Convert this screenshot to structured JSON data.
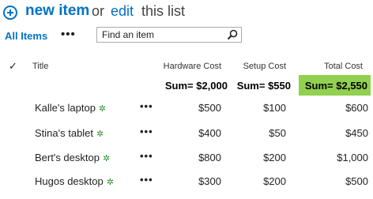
{
  "header": {
    "new_item_label": "new item",
    "or_text": "or",
    "edit_label": "edit",
    "this_list_text": "this list"
  },
  "toolbar": {
    "view_label": "All Items",
    "more_label": "•••",
    "search_placeholder": "Find an item"
  },
  "columns": {
    "check": "✓",
    "title": "Title",
    "hardware_cost": "Hardware Cost",
    "setup_cost": "Setup Cost",
    "total_cost": "Total Cost"
  },
  "totals": {
    "hardware_label": "Sum=",
    "hardware_value": "$2,000",
    "setup_label": "Sum=",
    "setup_value": "$550",
    "total_label": "Sum=",
    "total_value": "$2,550"
  },
  "rows": [
    {
      "title": "Kalle's laptop",
      "badge": "✲",
      "actions": "•••",
      "hardware": "$500",
      "setup": "$100",
      "total": "$600"
    },
    {
      "title": "Stina's tablet",
      "badge": "✲",
      "actions": "•••",
      "hardware": "$400",
      "setup": "$50",
      "total": "$450"
    },
    {
      "title": "Bert's desktop",
      "badge": "✲",
      "actions": "•••",
      "hardware": "$800",
      "setup": "$200",
      "total": "$1,000"
    },
    {
      "title": "Hugos desktop",
      "badge": "✲",
      "actions": "•••",
      "hardware": "$300",
      "setup": "$200",
      "total": "$500"
    }
  ],
  "colors": {
    "link": "#0072c6",
    "total_highlight": "#92d050",
    "new_badge": "#2f8f2f"
  },
  "icons": {
    "new": "plus-circle-icon",
    "search": "search-icon",
    "new_badge": "new-item-badge-icon",
    "check": "check-icon"
  }
}
